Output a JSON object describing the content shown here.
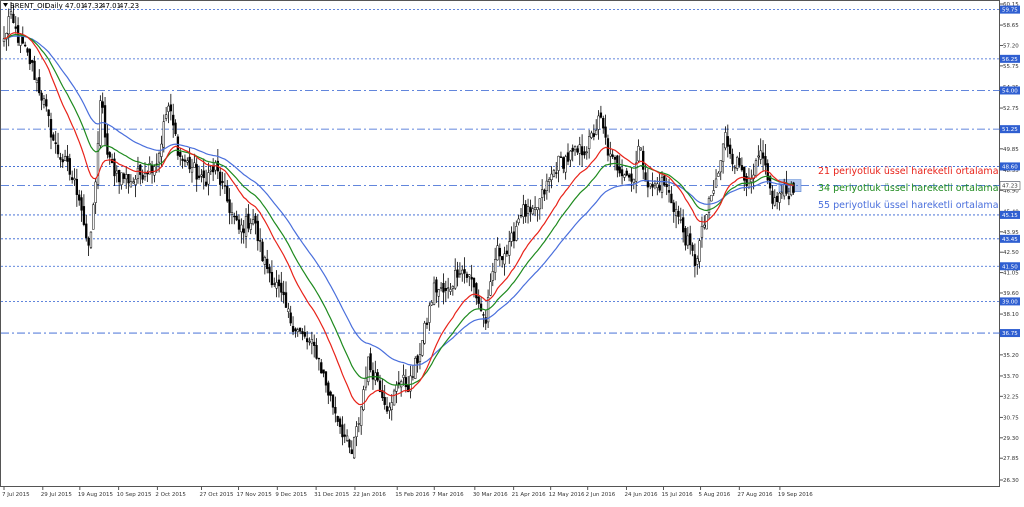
{
  "header": {
    "symbol": "BRENT_OIL",
    "timeframe": "Daily",
    "open": "47.01",
    "high": "47.32",
    "low": "47.01",
    "close": "47.23"
  },
  "colors": {
    "ema21": "#e8231a",
    "ema34": "#1e8a1e",
    "ema55": "#4a6fdc",
    "level_box": "#2f5fd1",
    "level_line": "#2f5fd1",
    "candles": "#000000"
  },
  "annotations": [
    {
      "text": "21 periyotluk üssel hareketli ortalama",
      "series": "ema21"
    },
    {
      "text": "34 periyotluk üssel hareketli ortalama",
      "series": "ema34"
    },
    {
      "text": "55 periyotluk üssel hareketli ortalama",
      "series": "ema55"
    }
  ],
  "chart_data": {
    "type": "line",
    "price_range": [
      26.3,
      60.15
    ],
    "date_range": [
      "2015-07-07",
      "2016-09-27"
    ],
    "y_ticks": [
      "60.15",
      "58.65",
      "57.20",
      "55.75",
      "54.25",
      "52.75",
      "51.30",
      "49.85",
      "48.35",
      "46.90",
      "45.40",
      "43.95",
      "42.50",
      "41.05",
      "39.60",
      "38.10",
      "36.65",
      "35.20",
      "33.70",
      "32.25",
      "30.75",
      "29.30",
      "27.85",
      "26.30"
    ],
    "x_ticks": [
      "7 Jul 2015",
      "29 Jul 2015",
      "19 Aug 2015",
      "10 Sep 2015",
      "2 Oct 2015",
      "27 Oct 2015",
      "17 Nov 2015",
      "9 Dec 2015",
      "31 Dec 2015",
      "22 Jan 2016",
      "15 Feb 2016",
      "7 Mar 2016",
      "30 Mar 2016",
      "21 Apr 2016",
      "12 May 2016",
      "2 Jun 2016",
      "24 Jun 2016",
      "15 Jul 2016",
      "5 Aug 2016",
      "27 Aug 2016",
      "19 Sep 2016"
    ],
    "levels": [
      {
        "label": "59.75",
        "value": 59.75,
        "style": "dotted"
      },
      {
        "label": "56.25",
        "value": 56.25,
        "style": "dotted"
      },
      {
        "label": "54.00",
        "value": 54.0,
        "style": "dashdot"
      },
      {
        "label": "51.25",
        "value": 51.25,
        "style": "dashdot"
      },
      {
        "label": "48.60",
        "value": 48.6,
        "style": "dotted"
      },
      {
        "label": "47.25",
        "value": 47.25,
        "style": "dashdot"
      },
      {
        "label": "45.15",
        "value": 45.15,
        "style": "dotted"
      },
      {
        "label": "43.45",
        "value": 43.45,
        "style": "dotted"
      },
      {
        "label": "41.50",
        "value": 41.5,
        "style": "dotted"
      },
      {
        "label": "39.00",
        "value": 39.0,
        "style": "dotted"
      },
      {
        "label": "36.75",
        "value": 36.75,
        "style": "dashdot"
      }
    ],
    "current_price": {
      "label": "47.23",
      "value": 47.23
    },
    "price_path": [
      {
        "date": "2015-07-07",
        "close": 57.5
      },
      {
        "date": "2015-07-10",
        "close": 59.3
      },
      {
        "date": "2015-07-15",
        "close": 57.8
      },
      {
        "date": "2015-07-22",
        "close": 56.0
      },
      {
        "date": "2015-07-29",
        "close": 53.4
      },
      {
        "date": "2015-08-05",
        "close": 50.0
      },
      {
        "date": "2015-08-12",
        "close": 48.5
      },
      {
        "date": "2015-08-19",
        "close": 46.5
      },
      {
        "date": "2015-08-24",
        "close": 42.4
      },
      {
        "date": "2015-08-27",
        "close": 46.0
      },
      {
        "date": "2015-08-31",
        "close": 53.5
      },
      {
        "date": "2015-09-04",
        "close": 49.0
      },
      {
        "date": "2015-09-10",
        "close": 48.0
      },
      {
        "date": "2015-09-18",
        "close": 47.6
      },
      {
        "date": "2015-09-24",
        "close": 48.3
      },
      {
        "date": "2015-10-02",
        "close": 49.0
      },
      {
        "date": "2015-10-08",
        "close": 53.0
      },
      {
        "date": "2015-10-15",
        "close": 49.2
      },
      {
        "date": "2015-10-22",
        "close": 48.5
      },
      {
        "date": "2015-10-27",
        "close": 47.5
      },
      {
        "date": "2015-11-04",
        "close": 48.5
      },
      {
        "date": "2015-11-11",
        "close": 46.0
      },
      {
        "date": "2015-11-17",
        "close": 44.0
      },
      {
        "date": "2015-11-25",
        "close": 45.0
      },
      {
        "date": "2015-12-01",
        "close": 42.0
      },
      {
        "date": "2015-12-09",
        "close": 40.0
      },
      {
        "date": "2015-12-16",
        "close": 37.8
      },
      {
        "date": "2015-12-23",
        "close": 36.5
      },
      {
        "date": "2015-12-31",
        "close": 35.5
      },
      {
        "date": "2016-01-07",
        "close": 32.5
      },
      {
        "date": "2016-01-13",
        "close": 30.5
      },
      {
        "date": "2016-01-20",
        "close": 28.0
      },
      {
        "date": "2016-01-25",
        "close": 31.0
      },
      {
        "date": "2016-01-29",
        "close": 34.7
      },
      {
        "date": "2016-02-04",
        "close": 33.5
      },
      {
        "date": "2016-02-11",
        "close": 31.0
      },
      {
        "date": "2016-02-15",
        "close": 33.5
      },
      {
        "date": "2016-02-22",
        "close": 33.0
      },
      {
        "date": "2016-02-29",
        "close": 36.0
      },
      {
        "date": "2016-03-07",
        "close": 40.0
      },
      {
        "date": "2016-03-14",
        "close": 39.5
      },
      {
        "date": "2016-03-21",
        "close": 41.5
      },
      {
        "date": "2016-03-28",
        "close": 40.5
      },
      {
        "date": "2016-04-05",
        "close": 37.5
      },
      {
        "date": "2016-04-11",
        "close": 42.5
      },
      {
        "date": "2016-04-18",
        "close": 42.5
      },
      {
        "date": "2016-04-25",
        "close": 45.5
      },
      {
        "date": "2016-05-02",
        "close": 45.0
      },
      {
        "date": "2016-05-09",
        "close": 47.0
      },
      {
        "date": "2016-05-16",
        "close": 48.8
      },
      {
        "date": "2016-05-26",
        "close": 49.5
      },
      {
        "date": "2016-06-02",
        "close": 50.0
      },
      {
        "date": "2016-06-09",
        "close": 52.0
      },
      {
        "date": "2016-06-15",
        "close": 49.0
      },
      {
        "date": "2016-06-24",
        "close": 48.2
      },
      {
        "date": "2016-06-27",
        "close": 47.5
      },
      {
        "date": "2016-07-01",
        "close": 50.0
      },
      {
        "date": "2016-07-07",
        "close": 47.0
      },
      {
        "date": "2016-07-15",
        "close": 47.5
      },
      {
        "date": "2016-07-22",
        "close": 45.5
      },
      {
        "date": "2016-07-29",
        "close": 43.0
      },
      {
        "date": "2016-08-02",
        "close": 41.8
      },
      {
        "date": "2016-08-08",
        "close": 45.0
      },
      {
        "date": "2016-08-15",
        "close": 48.0
      },
      {
        "date": "2016-08-19",
        "close": 50.8
      },
      {
        "date": "2016-08-24",
        "close": 49.0
      },
      {
        "date": "2016-08-29",
        "close": 48.5
      },
      {
        "date": "2016-09-02",
        "close": 47.0
      },
      {
        "date": "2016-09-08",
        "close": 49.5
      },
      {
        "date": "2016-09-13",
        "close": 47.0
      },
      {
        "date": "2016-09-16",
        "close": 46.0
      },
      {
        "date": "2016-09-21",
        "close": 46.9
      },
      {
        "date": "2016-09-23",
        "close": 46.7
      },
      {
        "date": "2016-09-27",
        "close": 47.23
      }
    ]
  }
}
